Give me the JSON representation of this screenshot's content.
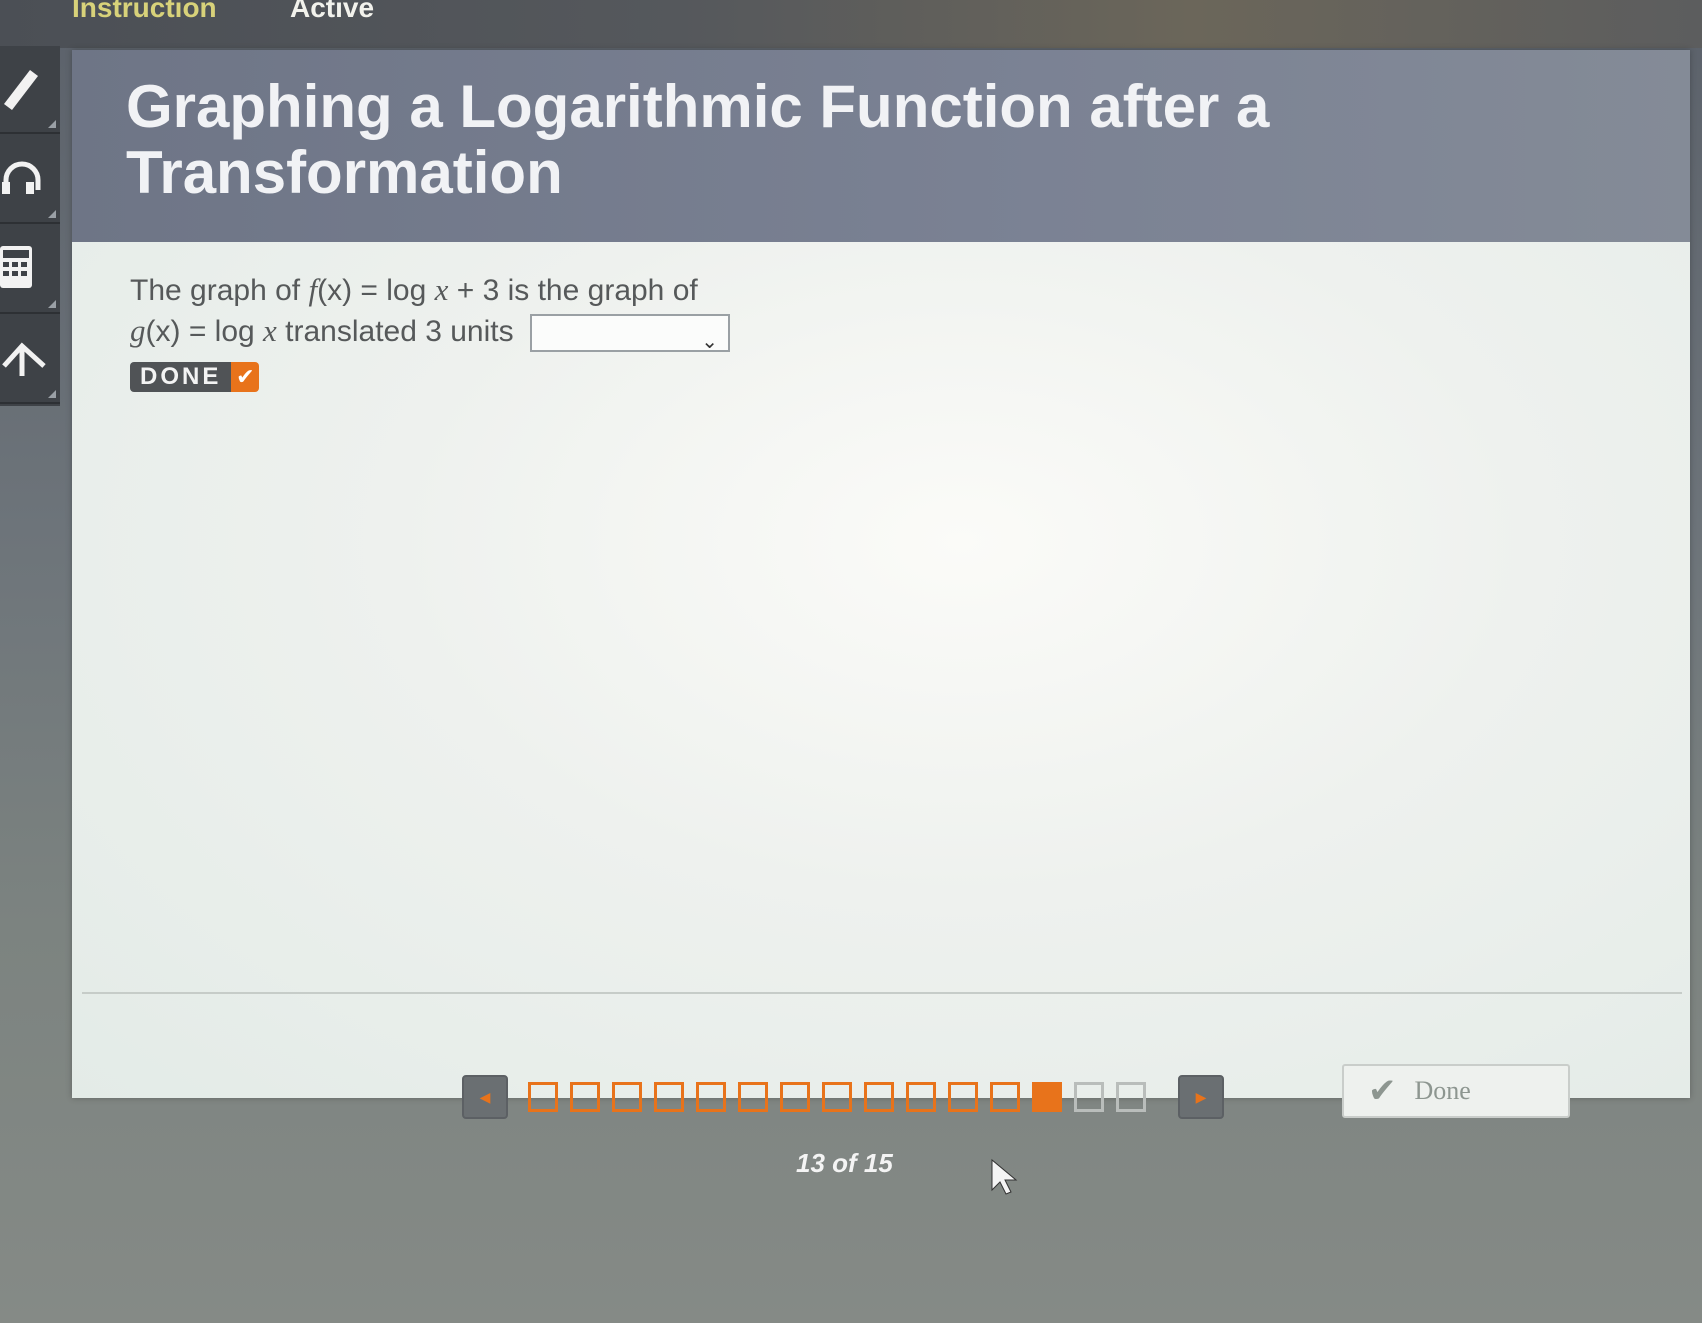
{
  "topbar": {
    "tab_instruction": "Instruction",
    "tab_active": "Active"
  },
  "tools": [
    {
      "icon": "pencil-icon"
    },
    {
      "icon": "headphones-icon"
    },
    {
      "icon": "calculator-icon"
    },
    {
      "icon": "up-arrow-icon"
    }
  ],
  "lesson": {
    "title": "Graphing a Logarithmic Function after a Transformation",
    "question_line1_prefix": "The graph of ",
    "question_f": "f",
    "question_line1_mid": "(x) = log ",
    "question_x": "x",
    "question_line1_suffix": " + 3 is the graph of",
    "question_g": "g",
    "question_line2_mid": "(x) = log ",
    "question_line2_suffix": " translated 3 units",
    "answer_selected": "",
    "done_badge": "DONE"
  },
  "footer": {
    "done_button_label": "Done"
  },
  "pager": {
    "current_page": 13,
    "total_pages": 15,
    "label": "13 of 15",
    "completed": 12
  },
  "colors": {
    "accent": "#e8731b",
    "header": "#7b8294",
    "card": "#eef1ee"
  }
}
